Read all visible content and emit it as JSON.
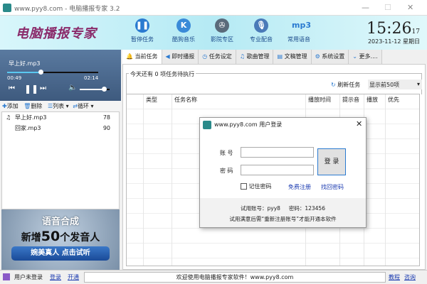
{
  "window": {
    "title": "www.pyy8.com - 电脑播报专家 3.2",
    "minimize": "—",
    "maximize": "☐",
    "close": "✕"
  },
  "header": {
    "logo": "电脑播报专家",
    "buttons": [
      {
        "label": "暂停任务",
        "icon": "pause-icon",
        "glyph": "❚❚",
        "color": "#2a7ad0"
      },
      {
        "label": "酷狗音乐",
        "icon": "kugou-icon",
        "glyph": "K",
        "color": "#3a8ad8"
      },
      {
        "label": "影院专区",
        "icon": "film-reel-icon",
        "glyph": "✇",
        "color": "#5a6a7a"
      },
      {
        "label": "专业配音",
        "icon": "microphone-icon",
        "glyph": "🎙",
        "color": "#4a7ab8"
      },
      {
        "label": "常用语音",
        "icon": "mp3-icon",
        "glyph": "mp3",
        "color": "#2a7ad0"
      }
    ],
    "clock": {
      "time": "15:26",
      "seconds": "17",
      "date": "2023-11-12 星期日"
    }
  },
  "player": {
    "track": "早上好.mp3",
    "elapsed": "00:49",
    "total": "02:14",
    "progress": 0.37,
    "volume": 0.8
  },
  "list_toolbar": {
    "add": "添加",
    "delete": "删除",
    "list": "列表",
    "loop": "循环"
  },
  "playlist": [
    {
      "name": "早上好.mp3",
      "value": "78",
      "playing": true
    },
    {
      "name": "回家.mp3",
      "value": "90",
      "playing": false
    }
  ],
  "ad": {
    "line1": "语音合成",
    "line2a": "新增",
    "line2b": "50",
    "line2c": "个发音人",
    "button": "婉美真人  点击试听"
  },
  "tabs": [
    {
      "label": "当前任务",
      "icon": "bell-icon"
    },
    {
      "label": "即时播报",
      "icon": "speaker-icon"
    },
    {
      "label": "任务设定",
      "icon": "clock-icon"
    },
    {
      "label": "歌曲管理",
      "icon": "music-icon"
    },
    {
      "label": "文稿管理",
      "icon": "document-icon"
    },
    {
      "label": "系统设置",
      "icon": "gear-icon"
    },
    {
      "label": "更多....",
      "icon": "chevron-down-icon"
    }
  ],
  "tasks": {
    "group_title": "今天还有 0 项任务待执行",
    "refresh": "刷新任务",
    "show_select": "显示前50项",
    "columns": [
      "类型",
      "任务名称",
      "播放时间",
      "提示音",
      "播放",
      "优先"
    ]
  },
  "dialog": {
    "title": "www.pyy8.com 用户登录",
    "account_label": "账 号",
    "password_label": "密 码",
    "account_value": "",
    "password_value": "",
    "login": "登 录",
    "remember": "记住密码",
    "remember_checked": false,
    "register": "免费注册",
    "recover": "找回密码",
    "trial": "试用账号：pyy8     密码：123456",
    "note": "试用满意后需“重新注册账号”才能开通本软件"
  },
  "status": {
    "user": "用户未登录",
    "login": "登录",
    "open": "开通",
    "message": "欢迎使用电脑播报专家软件！www.pyy8.com",
    "tutorial": "教程",
    "consult": "咨询"
  }
}
